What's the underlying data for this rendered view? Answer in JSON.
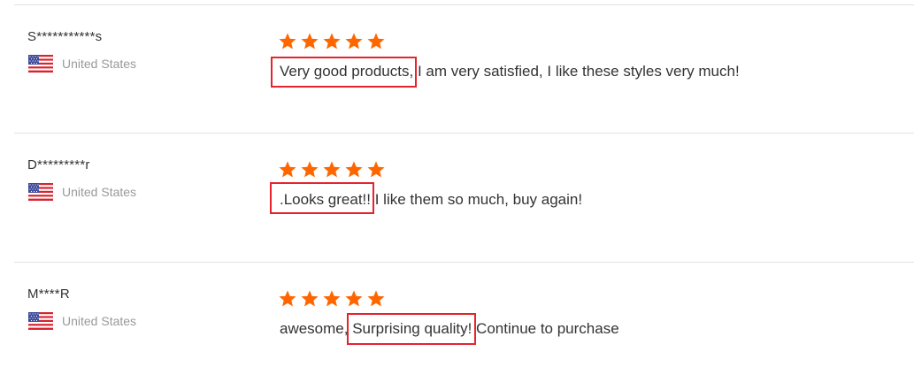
{
  "colors": {
    "star": "#ff6600",
    "highlight_border": "#e5242d",
    "divider": "#e2e2e2",
    "country_text": "#999999"
  },
  "reviews": [
    {
      "name": "S***********s",
      "country": "United States",
      "flag_icon": "us-flag-icon",
      "rating": 5,
      "text_before": "",
      "highlight": "Very good products,",
      "text_after": " I am very satisfied, I like these styles very much!"
    },
    {
      "name": "D*********r",
      "country": "United States",
      "flag_icon": "us-flag-icon",
      "rating": 5,
      "text_before": "",
      "highlight": ".Looks great!!",
      "text_after": " I like them so much, buy again!"
    },
    {
      "name": "M****R",
      "country": "United States",
      "flag_icon": "us-flag-icon",
      "rating": 5,
      "text_before": "awesome, ",
      "highlight": "Surprising quality!",
      "text_after": " Continue to purchase"
    }
  ]
}
